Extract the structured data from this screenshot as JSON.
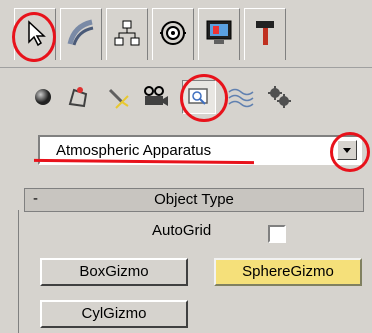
{
  "annotation_color": "#e8121b",
  "tabs": [
    {
      "name": "create",
      "icon": "cursor-arrow-icon"
    },
    {
      "name": "modify",
      "icon": "modify-curve-icon"
    },
    {
      "name": "hierarchy",
      "icon": "hierarchy-icon"
    },
    {
      "name": "motion",
      "icon": "motion-icon"
    },
    {
      "name": "display",
      "icon": "display-monitor-icon"
    },
    {
      "name": "utilities",
      "icon": "hammer-icon"
    }
  ],
  "subcategories": [
    {
      "icon": "geometry-sphere-icon"
    },
    {
      "icon": "shapes-icon"
    },
    {
      "icon": "lights-icon"
    },
    {
      "icon": "cameras-icon"
    },
    {
      "icon": "helpers-icon",
      "selected": true
    },
    {
      "icon": "space-warps-icon"
    },
    {
      "icon": "systems-icon"
    }
  ],
  "dropdown": {
    "value": "Atmospheric Apparatus"
  },
  "rollout": {
    "minus": "-",
    "title": "Object Type",
    "autogrid_label": "AutoGrid",
    "buttons": [
      "BoxGizmo",
      "SphereGizmo",
      "CylGizmo"
    ],
    "selected_button": "SphereGizmo"
  }
}
